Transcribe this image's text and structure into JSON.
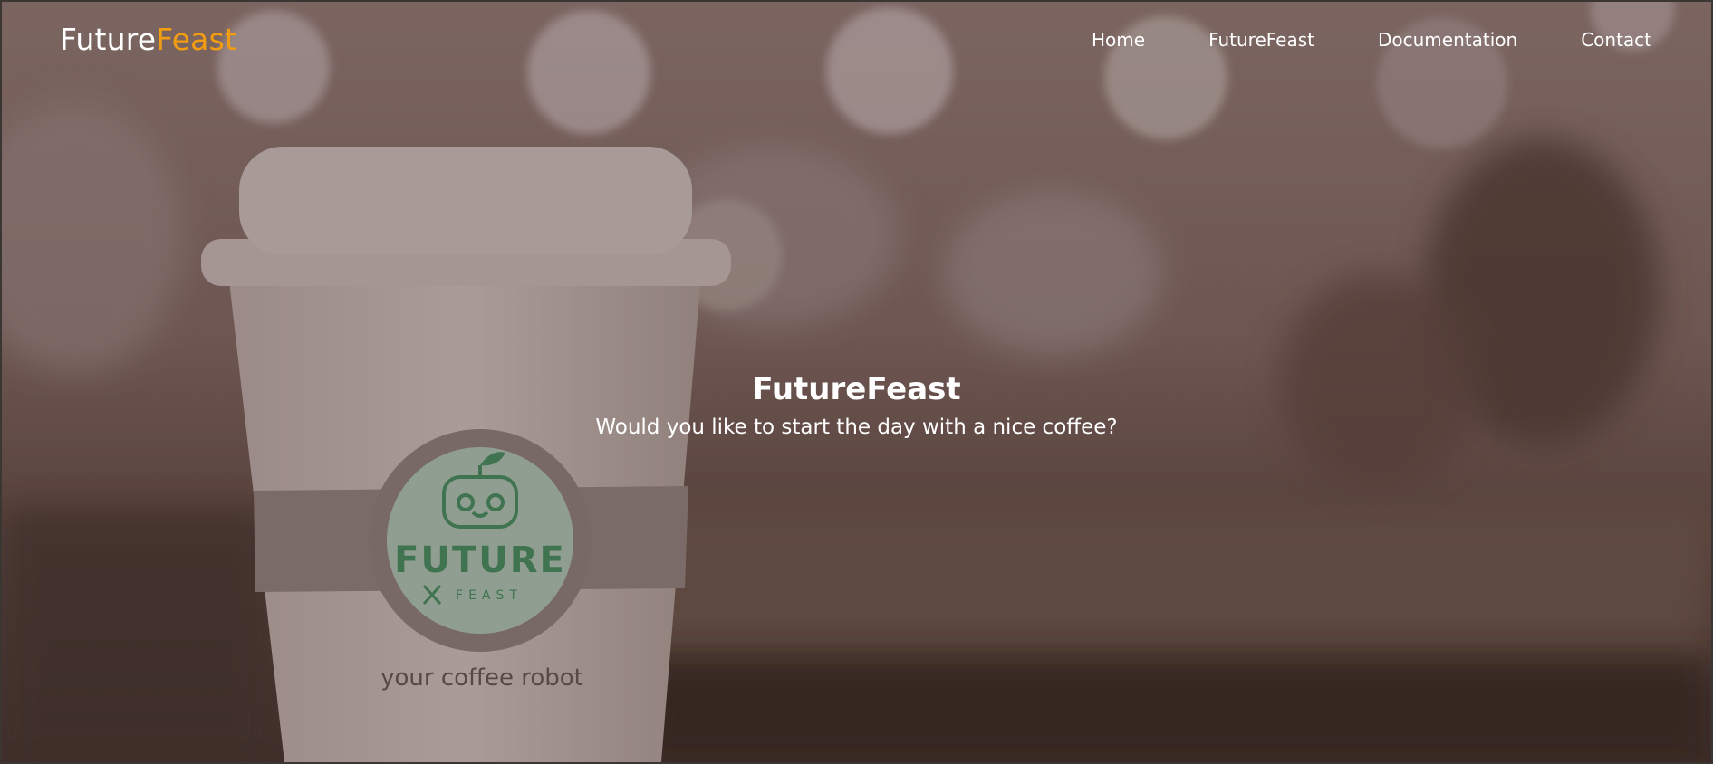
{
  "header": {
    "logo_primary": "Future",
    "logo_accent": "Feast"
  },
  "nav": {
    "items": [
      "Home",
      "FutureFeast",
      "Documentation",
      "Contact"
    ]
  },
  "hero": {
    "title": "FutureFeast",
    "subtitle": "Would you like to start the day with a nice coffee?",
    "cup": {
      "logo_word": "FUTURE",
      "logo_subword": "FEAST",
      "slogan": "your coffee robot"
    }
  },
  "colors": {
    "accent": "#f29c11",
    "text": "#ffffff",
    "logo_green": "#3e8a5c"
  }
}
